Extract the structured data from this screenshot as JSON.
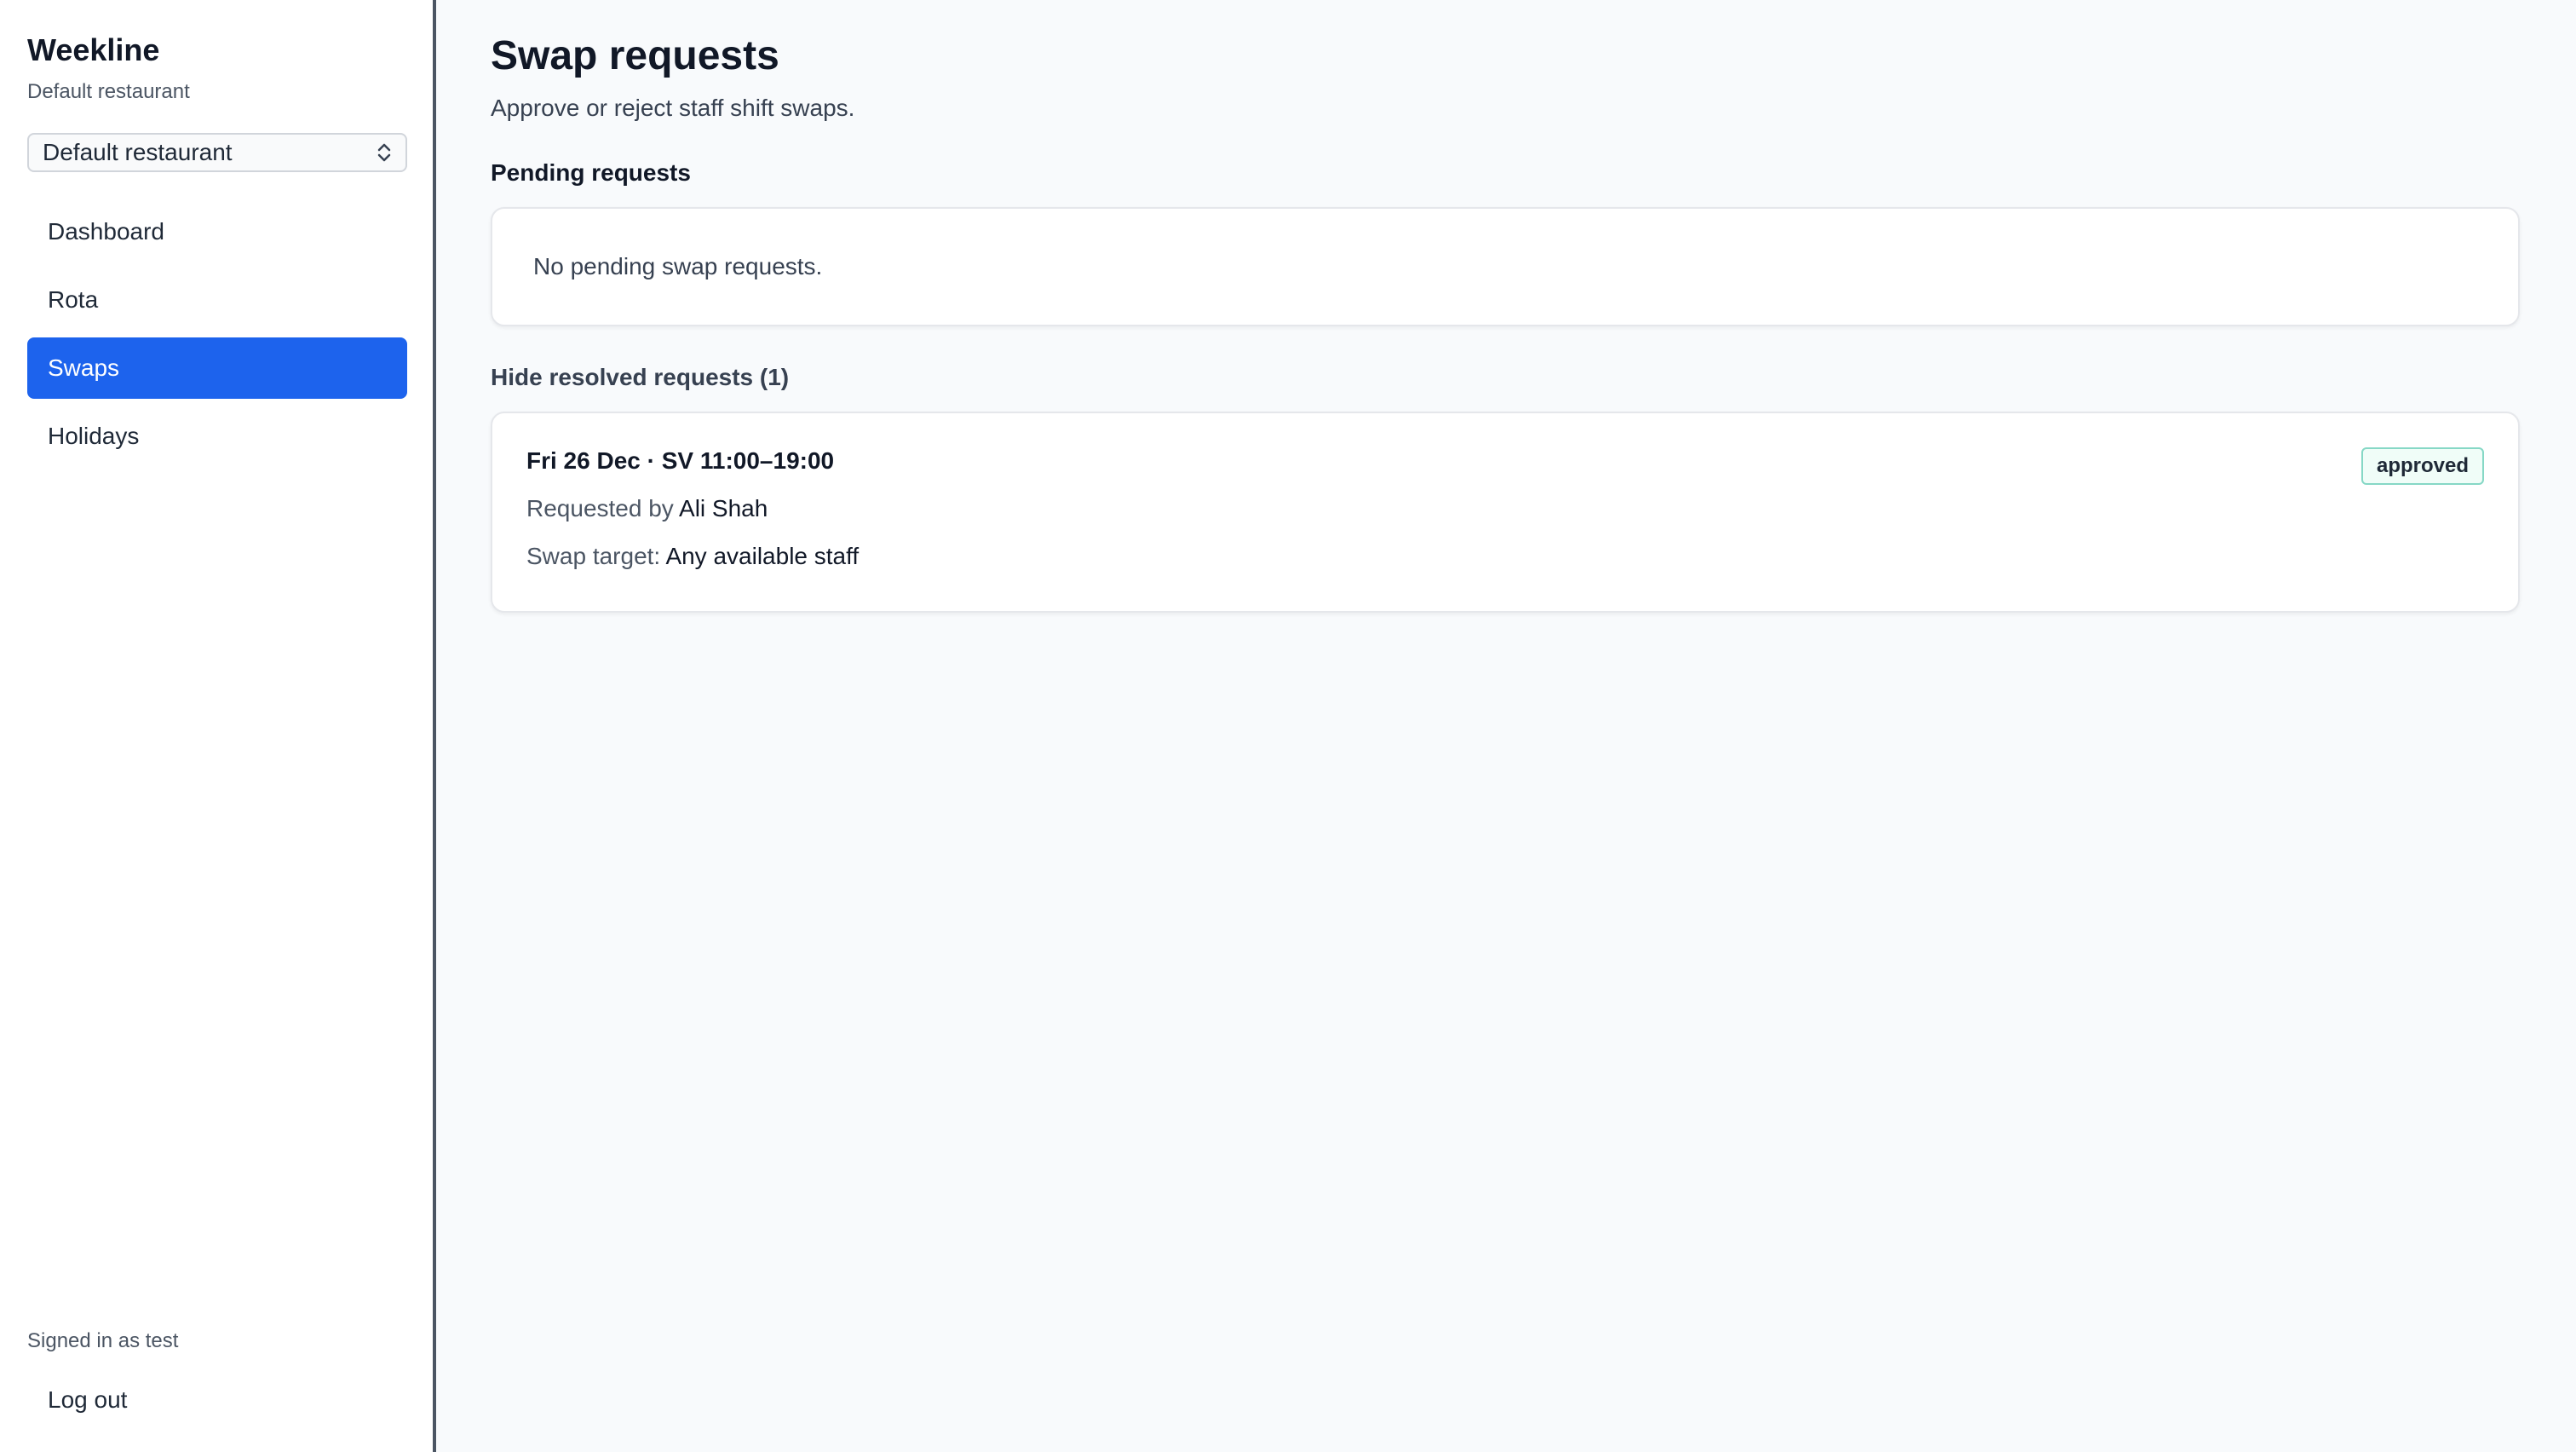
{
  "app": {
    "name": "Weekline",
    "subtitle": "Default restaurant"
  },
  "restaurant_select": {
    "value": "Default restaurant",
    "icon": "chevron-updown-icon"
  },
  "nav": {
    "items": [
      {
        "label": "Dashboard",
        "active": false
      },
      {
        "label": "Rota",
        "active": false
      },
      {
        "label": "Swaps",
        "active": true
      },
      {
        "label": "Holidays",
        "active": false
      }
    ]
  },
  "footer": {
    "signed_in": "Signed in as test",
    "logout": "Log out"
  },
  "page": {
    "title": "Swap requests",
    "subtitle": "Approve or reject staff shift swaps."
  },
  "pending": {
    "heading": "Pending requests",
    "empty_message": "No pending swap requests."
  },
  "resolved": {
    "toggle_label": "Hide resolved requests (1)",
    "items": [
      {
        "title": "Fri 26 Dec · SV 11:00–19:00",
        "requested_by_label": "Requested by",
        "requested_by": "Ali Shah",
        "target_label": "Swap target:",
        "target": "Any available staff",
        "status": "approved"
      }
    ]
  },
  "colors": {
    "accent": "#1d63ed",
    "badge_border": "#86d8c6"
  }
}
